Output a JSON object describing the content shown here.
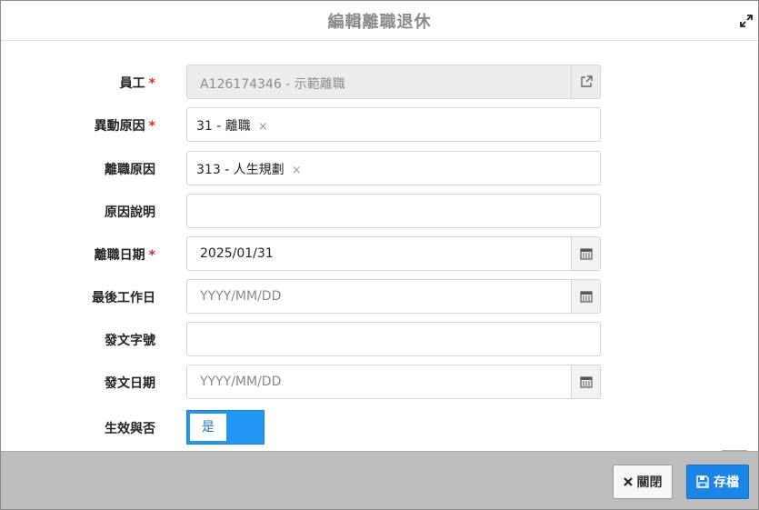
{
  "dialog": {
    "title": "編輯離職退休",
    "icons": {
      "expand": "expand-icon",
      "external": "external-link-icon",
      "calendar": "calendar-icon",
      "scroll": "chevron-down-icon",
      "close": "close-x-icon",
      "save": "floppy-disk-icon"
    }
  },
  "form": {
    "employee": {
      "label": "員工",
      "required_mark": "*",
      "value": "A126174346 - 示範離職"
    },
    "change_reason": {
      "label": "異動原因",
      "required_mark": "*",
      "tag": "31 - 離職",
      "remove": "×"
    },
    "leave_reason": {
      "label": "離職原因",
      "tag": "313 - 人生規劃",
      "remove": "×"
    },
    "reason_note": {
      "label": "原因說明",
      "value": ""
    },
    "leave_date": {
      "label": "離職日期",
      "required_mark": "*",
      "value": "2025/01/31"
    },
    "last_work_date": {
      "label": "最後工作日",
      "placeholder": "YYYY/MM/DD"
    },
    "doc_number": {
      "label": "發文字號",
      "value": ""
    },
    "doc_date": {
      "label": "發文日期",
      "placeholder": "YYYY/MM/DD"
    },
    "effective": {
      "label": "生效與否",
      "toggle_label": "是"
    }
  },
  "footer": {
    "close_label": "關閉",
    "save_label": "存檔"
  },
  "colors": {
    "primary": "#1b84e7",
    "required": "#c9302c",
    "footer_bg": "#bdbdbd"
  }
}
